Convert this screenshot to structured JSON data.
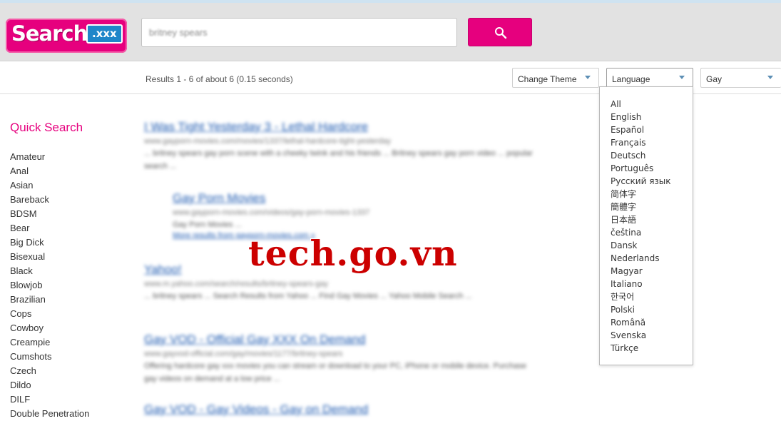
{
  "logo": {
    "word": "Search",
    "tld": ".xxx"
  },
  "search": {
    "query": "britney spears",
    "button_icon": "magnifier-icon"
  },
  "toolbar": {
    "results_text": "Results 1 - 6 of about 6 (0.15 seconds)",
    "theme_label": "Change Theme",
    "language_label": "Language",
    "category_label": "Gay"
  },
  "languages": [
    "All",
    "English",
    "Español",
    "Français",
    "Deutsch",
    "Português",
    "Русский язык",
    "简体字",
    "簡體字",
    "日本語",
    "čeština",
    "Dansk",
    "Nederlands",
    "Magyar",
    "Italiano",
    "한국어",
    "Polski",
    "Română",
    "Svenska",
    "Türkçe"
  ],
  "sidebar": {
    "title": "Quick Search",
    "categories": [
      "Amateur",
      "Anal",
      "Asian",
      "Bareback",
      "BDSM",
      "Bear",
      "Big Dick",
      "Bisexual",
      "Black",
      "Blowjob",
      "Brazilian",
      "Cops",
      "Cowboy",
      "Creampie",
      "Cumshots",
      "Czech",
      "Dildo",
      "DILF",
      "Double Penetration"
    ]
  },
  "results": [
    {
      "title": "I Was Tight Yesterday 3 - Lethal Hardcore",
      "url": "www.gayporn-movies.com/movies/1337/lethal-hardcore-tight-yesterday",
      "snippet": "... britney spears gay porn scene with a cheeky twink and his friends ... Britney spears gay porn video ... popular search ..."
    },
    {
      "title": "Gay Porn Movies",
      "url": "www.gayporn-movies.com/videos/gay-porn-movies-1337",
      "snippet": "Gay Porn Movies ...",
      "extra": "More results from gayporn-movies.com »"
    },
    {
      "title": "Yahoo!",
      "url": "www.m.yahoo.com/search/results/britney-spears-gay",
      "snippet": "... britney spears ... Search Results from Yahoo ... Find Gay Movies ... Yahoo Mobile Search ..."
    },
    {
      "title": "Gay VOD - Official Gay XXX On Demand",
      "url": "www.gayvod-official.com/gay/movies/1177/britney-spears",
      "snippet": "Offering hardcore gay xxx movies you can stream or download to your PC, iPhone or mobile device. Purchase gay videos on demand at a low price ..."
    },
    {
      "title": "Gay VOD - Gay Videos - Gay on Demand",
      "url": "",
      "snippet": ""
    }
  ],
  "watermark": "tech.go.vn"
}
